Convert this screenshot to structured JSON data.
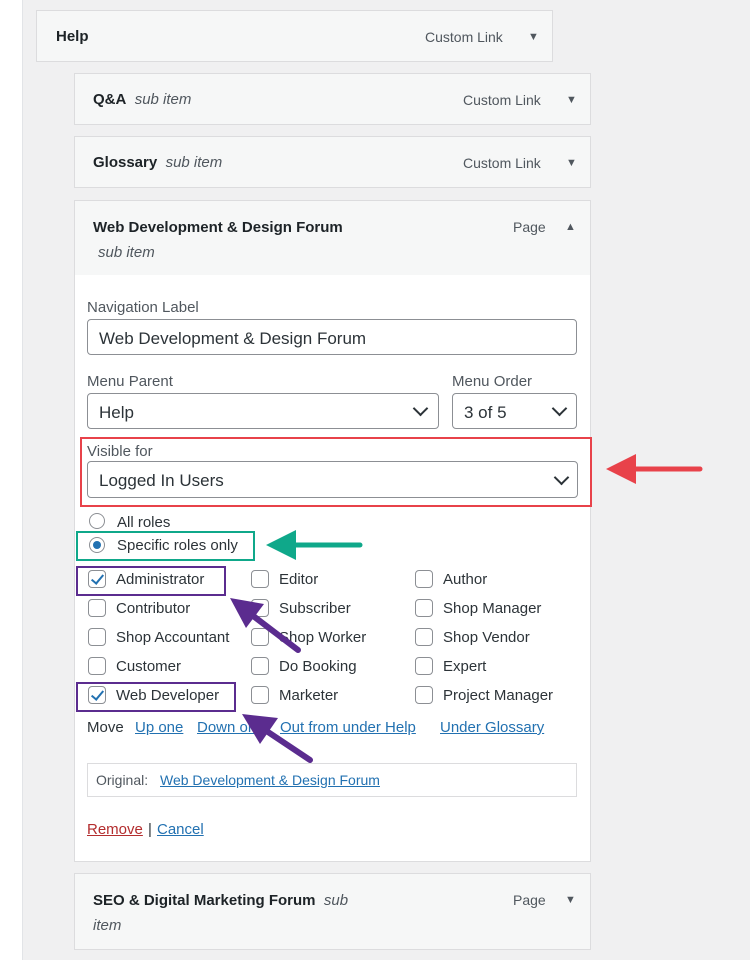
{
  "menu_items": [
    {
      "title": "Help",
      "sub": "",
      "type": "Custom Link"
    },
    {
      "title": "Q&A",
      "sub": "sub item",
      "type": "Custom Link"
    },
    {
      "title": "Glossary",
      "sub": "sub item",
      "type": "Custom Link"
    },
    {
      "title": "Web Development & Design Forum",
      "sub": "sub item",
      "type": "Page"
    },
    {
      "title": "SEO & Digital Marketing Forum",
      "sub": "sub",
      "sub2": "item",
      "type": "Page"
    }
  ],
  "settings": {
    "nav_label_label": "Navigation Label",
    "nav_label_value": "Web Development & Design Forum",
    "menu_parent_label": "Menu Parent",
    "menu_parent_value": "Help",
    "menu_order_label": "Menu Order",
    "menu_order_value": "3 of 5",
    "visible_for_label": "Visible for",
    "visible_for_value": "Logged In Users",
    "radio_all": "All roles",
    "radio_specific": "Specific roles only",
    "roles": [
      {
        "label": "Administrator",
        "checked": true
      },
      {
        "label": "Editor",
        "checked": false
      },
      {
        "label": "Author",
        "checked": false
      },
      {
        "label": "Contributor",
        "checked": false
      },
      {
        "label": "Subscriber",
        "checked": false
      },
      {
        "label": "Shop Manager",
        "checked": false
      },
      {
        "label": "Shop Accountant",
        "checked": false
      },
      {
        "label": "Shop Worker",
        "checked": false
      },
      {
        "label": "Shop Vendor",
        "checked": false
      },
      {
        "label": "Customer",
        "checked": false
      },
      {
        "label": "Do Booking",
        "checked": false
      },
      {
        "label": "Expert",
        "checked": false
      },
      {
        "label": "Web Developer",
        "checked": true
      },
      {
        "label": "Marketer",
        "checked": false
      },
      {
        "label": "Project Manager",
        "checked": false
      }
    ],
    "move_label": "Move",
    "move_links": [
      "Up one",
      "Down one",
      "Out from under Help",
      "Under Glossary"
    ],
    "original_label": "Original:",
    "original_link": "Web Development & Design Forum",
    "remove": "Remove",
    "separator": "|",
    "cancel": "Cancel"
  },
  "colors": {
    "red": "#e8424a",
    "teal": "#0fa88a",
    "purple": "#5b2c8f",
    "link": "#2271b1"
  }
}
